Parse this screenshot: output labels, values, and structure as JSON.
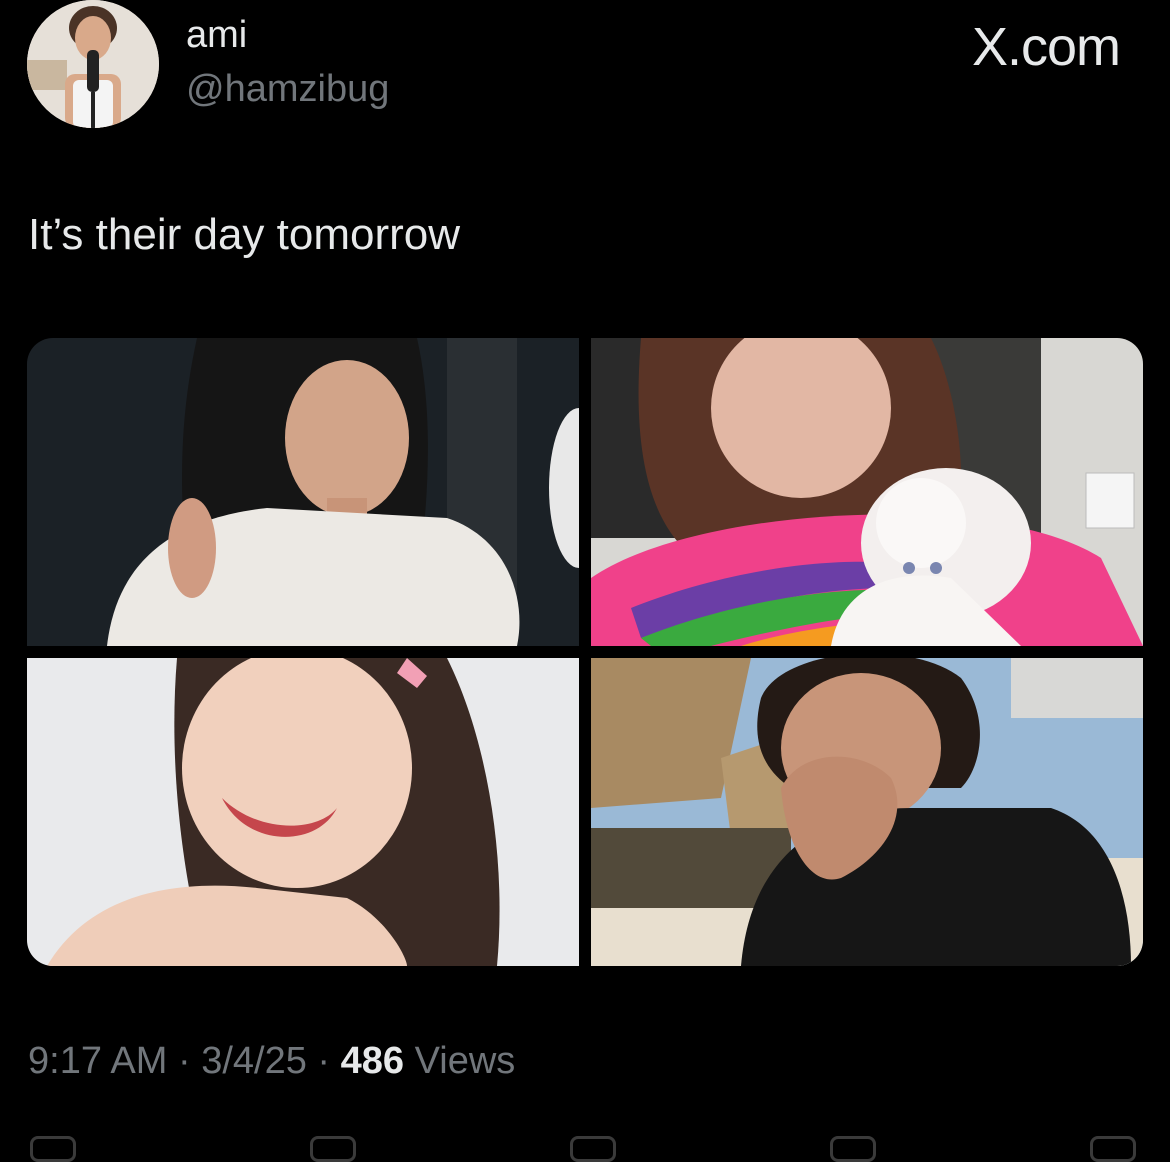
{
  "author": {
    "name": "ami",
    "handle": "@hamzibug",
    "avatar_icon": "user-avatar"
  },
  "brand": {
    "logo_text": "X.com"
  },
  "tweet": {
    "text": "It’s their day tomorrow"
  },
  "media": [
    {
      "icon": "photo"
    },
    {
      "icon": "photo"
    },
    {
      "icon": "photo"
    },
    {
      "icon": "photo"
    }
  ],
  "meta": {
    "time": "9:17 AM",
    "separator": "·",
    "date": "3/4/25",
    "views_count": "486",
    "views_label": "Views"
  },
  "colors": {
    "background": "#000000",
    "primary_text": "#e7e9ea",
    "secondary_text": "#71767b"
  }
}
